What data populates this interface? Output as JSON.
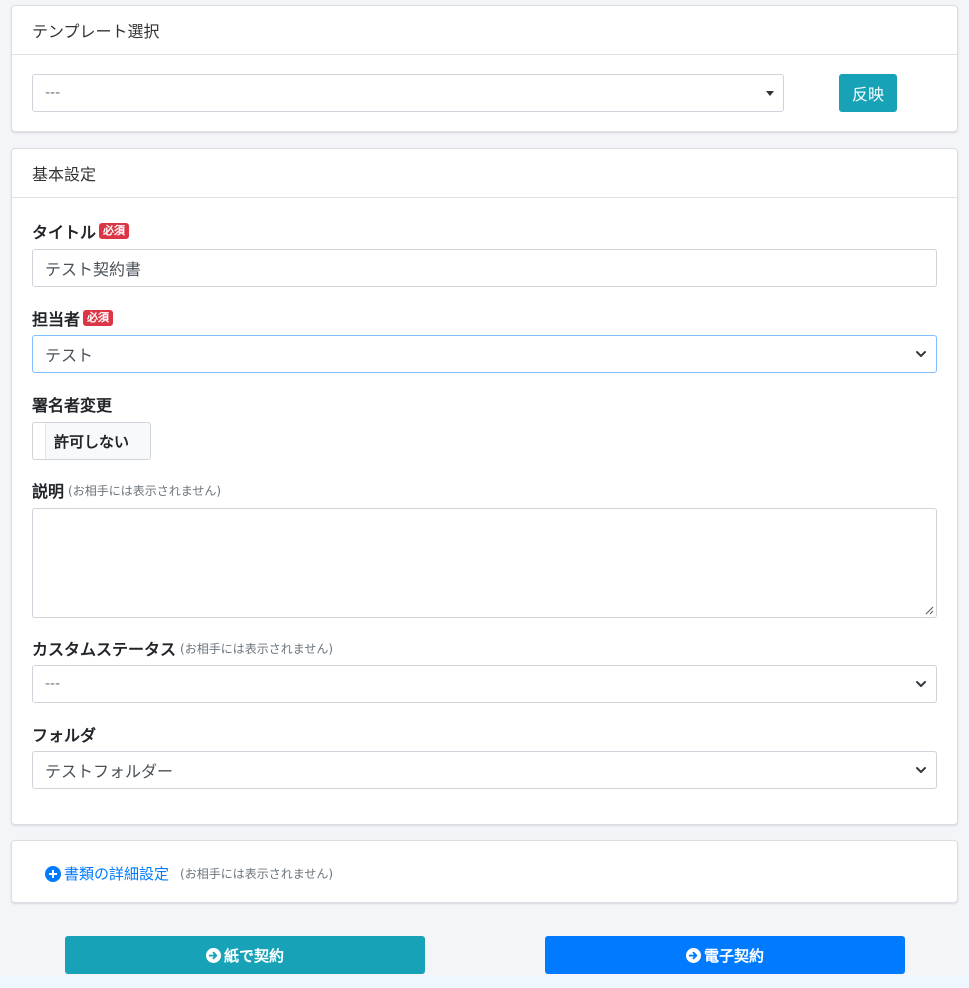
{
  "template_card": {
    "header": "テンプレート選択",
    "select_value": "---",
    "apply_button": "反映"
  },
  "basic_card": {
    "header": "基本設定",
    "title_label": "タイトル",
    "required_badge": "必須",
    "title_value": "テスト契約書",
    "assignee_label": "担当者",
    "assignee_value": "テスト",
    "signer_change_label": "署名者変更",
    "signer_change_toggle": "許可しない",
    "description_label": "説明",
    "hidden_note": "(お相手には表示されません)",
    "description_value": "",
    "custom_status_label": "カスタムステータス",
    "custom_status_value": "---",
    "folder_label": "フォルダ",
    "folder_value": "テストフォルダー"
  },
  "detail_card": {
    "link_label": "書類の詳細設定",
    "note": "(お相手には表示されません)"
  },
  "actions": {
    "paper_contract": "紙で契約",
    "electronic_contract": "電子契約"
  },
  "colors": {
    "teal": "#17a2b8",
    "primary": "#007bff",
    "required": "#dc3545"
  }
}
